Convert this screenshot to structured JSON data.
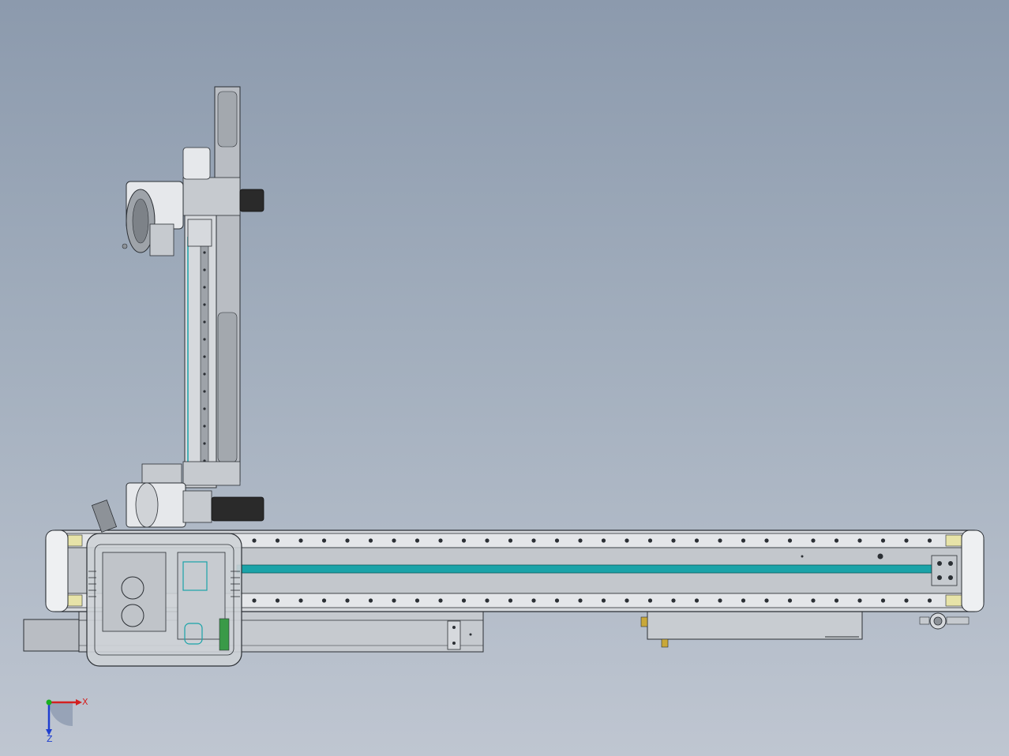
{
  "viewport": {
    "background_top": "#8c9aad",
    "background_bottom": "#bfc6d1"
  },
  "colors": {
    "metal_light": "#d6d9dd",
    "metal_mid": "#b9bdc3",
    "metal_dark": "#8d9298",
    "outline": "#2b2f34",
    "rail_cyan": "#1aa3a8",
    "rail_yellow": "#e7e3a8",
    "motor_black": "#2a2a2a",
    "green_part": "#3a9a48"
  },
  "triad": {
    "x_label": "X",
    "z_label": "Z",
    "x_color": "#d42020",
    "y_color": "#18b020",
    "z_color": "#1f3fd0"
  },
  "parts": {
    "vertical_axis": "vertical-linear-module",
    "horizontal_axis": "horizontal-linear-module",
    "carriage": "carriage-block",
    "top_motor": "upper-servo-motor",
    "bottom_motor": "lower-servo-motor",
    "base_beam": "base-support-beam",
    "cable_box": "cable-box-under-rail"
  }
}
